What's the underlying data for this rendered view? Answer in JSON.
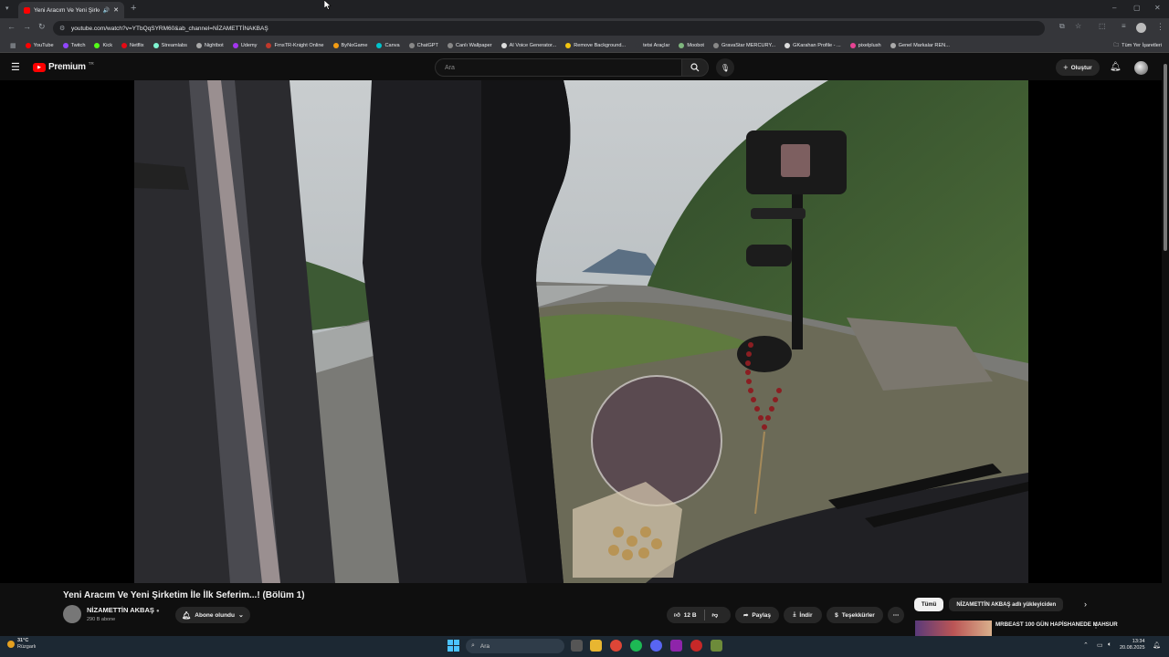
{
  "browser": {
    "tab_title": "Yeni Aracım Ve Yeni Şirketim",
    "url": "youtube.com/watch?v=YTbQqSYRM60&ab_channel=NİZAMETTİNAKBAŞ",
    "all_bookmarks": "Tüm Yer İşaretleri",
    "bookmarks": [
      {
        "label": "YouTube",
        "color": "#ff0000"
      },
      {
        "label": "Twitch",
        "color": "#9146ff"
      },
      {
        "label": "Kick",
        "color": "#53fc18"
      },
      {
        "label": "Netflix",
        "color": "#e50914"
      },
      {
        "label": "Streamlabs",
        "color": "#80f5d2"
      },
      {
        "label": "Nightbot",
        "color": "#aaaaaa"
      },
      {
        "label": "Udemy",
        "color": "#a435f0"
      },
      {
        "label": "FrnsTR-Knight Online",
        "color": "#c0392b"
      },
      {
        "label": "ByNoGame",
        "color": "#f39c12"
      },
      {
        "label": "Canva",
        "color": "#00c4cc"
      },
      {
        "label": "ChatGPT",
        "color": "#888888"
      },
      {
        "label": "Canlı Wallpaper",
        "color": "#888888"
      },
      {
        "label": "AI Voice Generator...",
        "color": "#dddddd"
      },
      {
        "label": "Remove Background...",
        "color": "#f1c40f"
      },
      {
        "label": "tetsi Araçlar",
        "color": "#35363a"
      },
      {
        "label": "Moobot",
        "color": "#7fb77e"
      },
      {
        "label": "GravaStar MERCURY...",
        "color": "#888888"
      },
      {
        "label": "GKarahan Profile - ...",
        "color": "#dddddd"
      },
      {
        "label": "pixelplush",
        "color": "#e84393"
      },
      {
        "label": "Genel Markalar REN...",
        "color": "#aaaaaa"
      }
    ]
  },
  "youtube": {
    "logo_text": "Premium",
    "logo_sup": "TR",
    "search_placeholder": "Ara",
    "create_label": "Oluştur",
    "video": {
      "title": "Yeni Aracım Ve Yeni Şirketim İle İlk Seferim...! (Bölüm 1)",
      "channel": "NİZAMETTİN AKBAŞ",
      "subscribers": "290 B abone",
      "subscribed_label": "Abone olundu",
      "likes": "12 B",
      "share_label": "Paylaş",
      "download_label": "İndir",
      "thanks_label": "Teşekkürler"
    },
    "chips": [
      "Tümü",
      "NİZAMETTİN AKBAŞ adlı yükleyiciden"
    ],
    "recommendation": {
      "title": "MRBEAST 100 GÜN HAPİSHANEDE MAHSUR"
    }
  },
  "taskbar": {
    "temp": "31°C",
    "weather": "Rüzgarlı",
    "search": "Ara",
    "time": "13:34",
    "date": "20.08.2025"
  }
}
